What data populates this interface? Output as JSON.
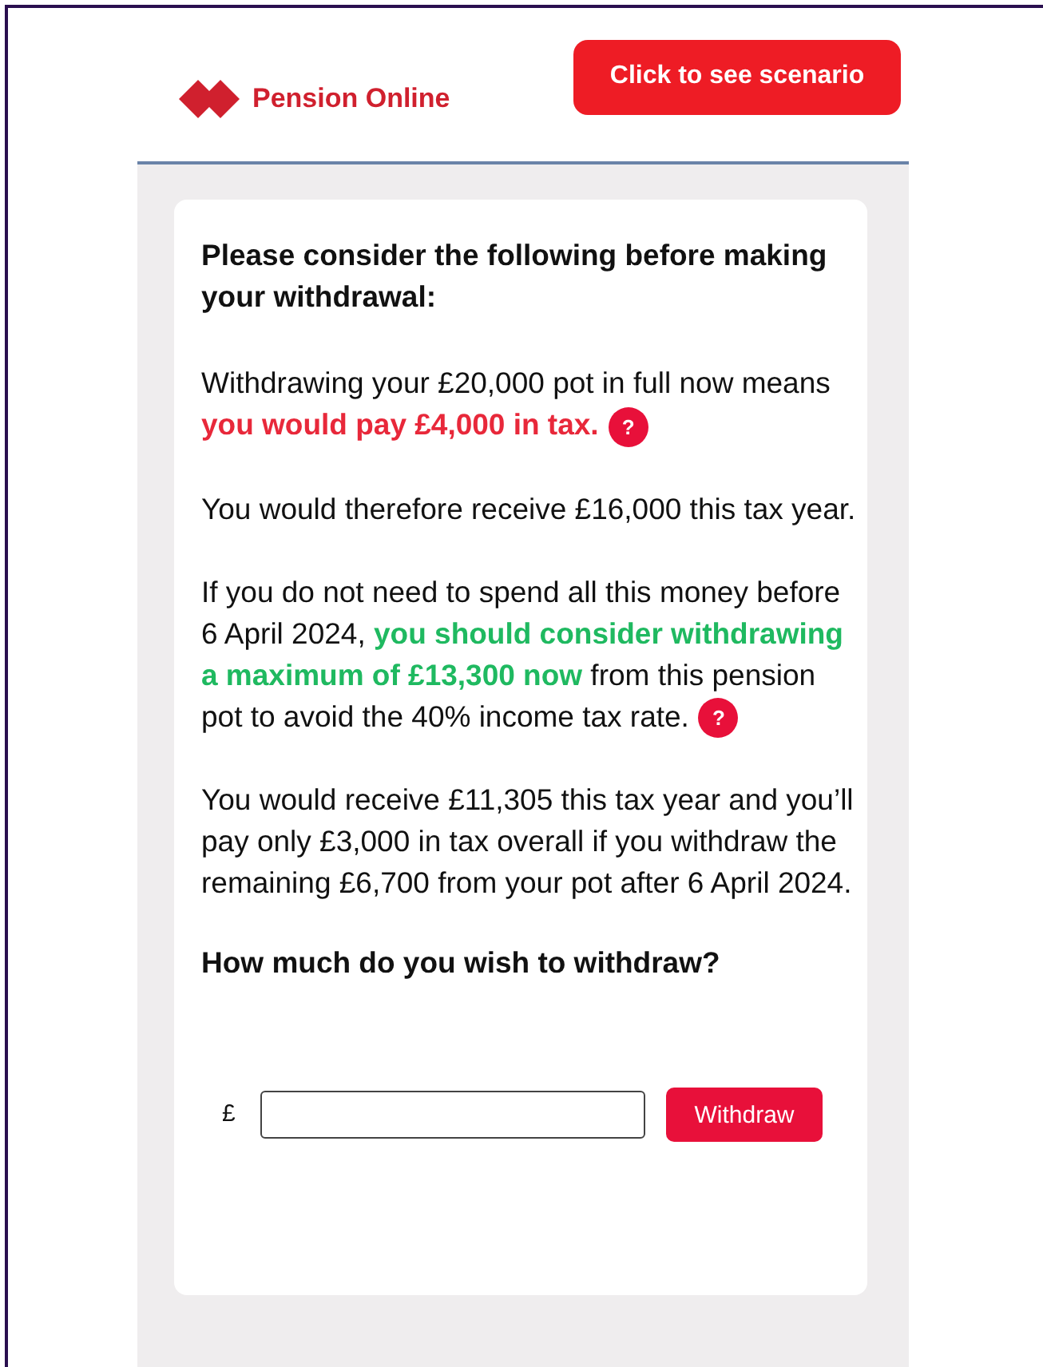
{
  "header": {
    "brand": "Pension Online",
    "scenario_button": "Click to see scenario"
  },
  "card": {
    "heading": "Please consider the following before making your withdrawal:",
    "paragraphs": [
      {
        "segments": [
          {
            "text": "Withdrawing your £20,000 pot in full now means ",
            "color": "#111111",
            "bold": false
          },
          {
            "text": "you would pay £4,000 in tax.",
            "color": "#e8283a",
            "bold": true
          }
        ],
        "help": "?"
      },
      {
        "segments": [
          {
            "text": "You would therefore receive £16,000 this tax year.",
            "color": "#111111",
            "bold": false
          }
        ]
      },
      {
        "segments": [
          {
            "text": "If you do not need to spend all this money before 6 April 2024, ",
            "color": "#111111",
            "bold": false
          },
          {
            "text": "you should consider withdrawing a maximum of £13,300 now",
            "color": "#1fb960",
            "bold": true
          },
          {
            "text": " from this pension pot to avoid the 40% income tax rate.",
            "color": "#111111",
            "bold": false
          }
        ],
        "help": "?"
      },
      {
        "segments": [
          {
            "text": "You would receive £11,305 this tax year and you’ll pay only £3,000 in tax overall if you withdraw the remaining £6,700 from your pot after 6 April 2024.",
            "color": "#111111",
            "bold": false
          }
        ]
      }
    ],
    "question": "How much do you wish to withdraw?",
    "amount": {
      "currency": "£",
      "button": "Withdraw"
    }
  }
}
